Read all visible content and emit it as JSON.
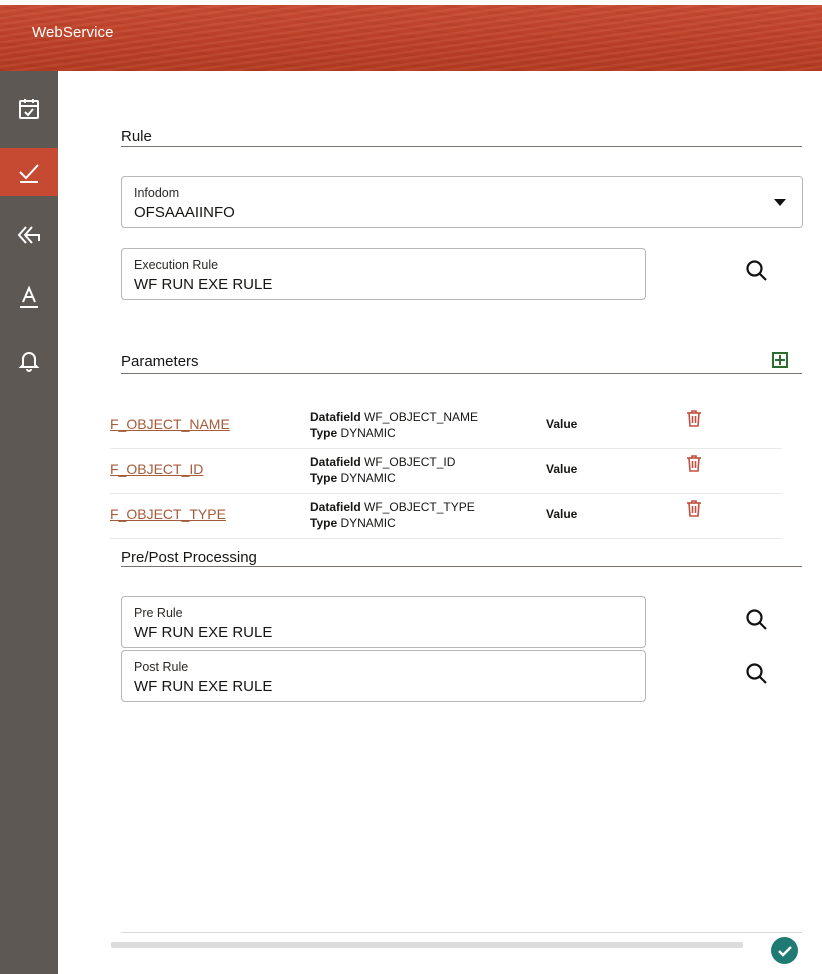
{
  "header": {
    "title": "WebService"
  },
  "sidebar": {
    "items": [
      {
        "icon": "calendar-check-icon"
      },
      {
        "icon": "check-icon",
        "active": true
      },
      {
        "icon": "double-back-arrow-icon"
      },
      {
        "icon": "text-format-icon"
      },
      {
        "icon": "bell-icon"
      }
    ]
  },
  "rule_section": {
    "title": "Rule",
    "infodom": {
      "label": "Infodom",
      "value": "OFSAAAIINFO"
    },
    "execution_rule": {
      "label": "Execution Rule",
      "value": "WF RUN EXE RULE"
    }
  },
  "parameters": {
    "title": "Parameters",
    "datafield_label": "Datafield",
    "type_label": "Type",
    "value_label": "Value",
    "rows": [
      {
        "name": "F_OBJECT_NAME",
        "datafield": "WF_OBJECT_NAME",
        "type": "DYNAMIC"
      },
      {
        "name": "F_OBJECT_ID",
        "datafield": "WF_OBJECT_ID",
        "type": "DYNAMIC"
      },
      {
        "name": "F_OBJECT_TYPE",
        "datafield": "WF_OBJECT_TYPE",
        "type": "DYNAMIC"
      }
    ]
  },
  "processing": {
    "title": "Pre/Post Processing",
    "pre_rule": {
      "label": "Pre Rule",
      "value": "WF RUN EXE RULE"
    },
    "post_rule": {
      "label": "Post Rule",
      "value": "WF RUN EXE RULE"
    }
  },
  "colors": {
    "header": "#c44a30",
    "sidebar": "#5e5854",
    "active": "#c64a31",
    "link": "#a55a3a",
    "ok": "#1f7a73"
  }
}
